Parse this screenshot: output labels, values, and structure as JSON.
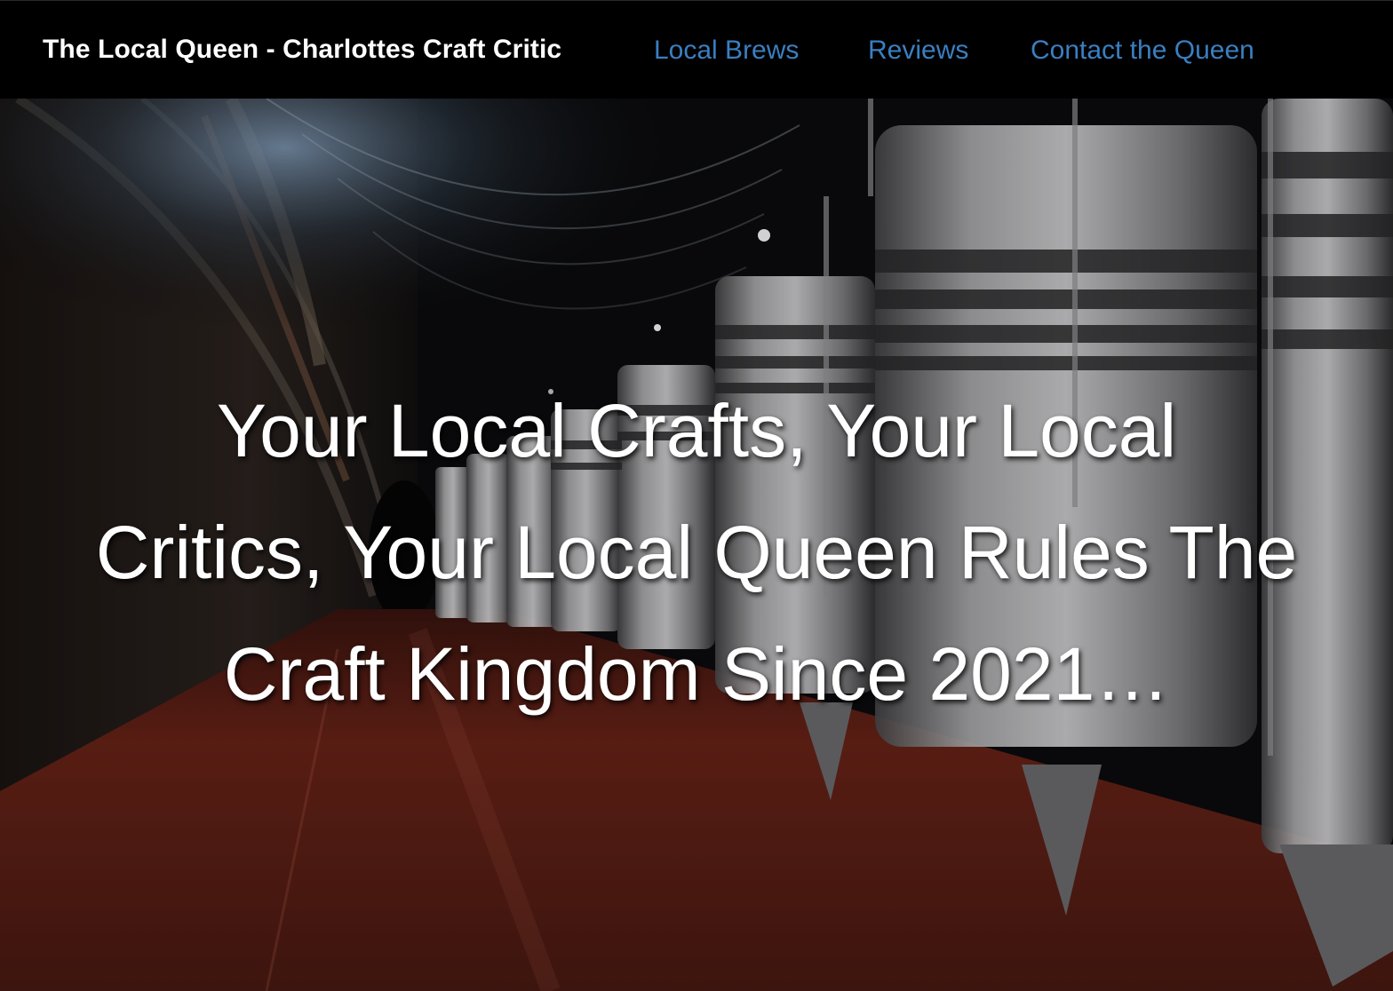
{
  "header": {
    "brand": "The Local Queen - Charlottes Craft Critic",
    "nav": [
      {
        "label": "Local Brews"
      },
      {
        "label": "Reviews"
      },
      {
        "label": "Contact the Queen"
      }
    ]
  },
  "hero": {
    "headline_lines": [
      "Your Local Crafts, Your Local",
      "Critics, Your Local Queen Rules The",
      "Craft Kingdom Since 2021…"
    ],
    "background_image": "fermentation-tank-cellar-photo"
  },
  "colors": {
    "nav_bar": "#000000",
    "brand_text": "#ffffff",
    "nav_link": "#3a7fc1",
    "headline": "#ffffff",
    "floor": "#7a2a1e"
  }
}
